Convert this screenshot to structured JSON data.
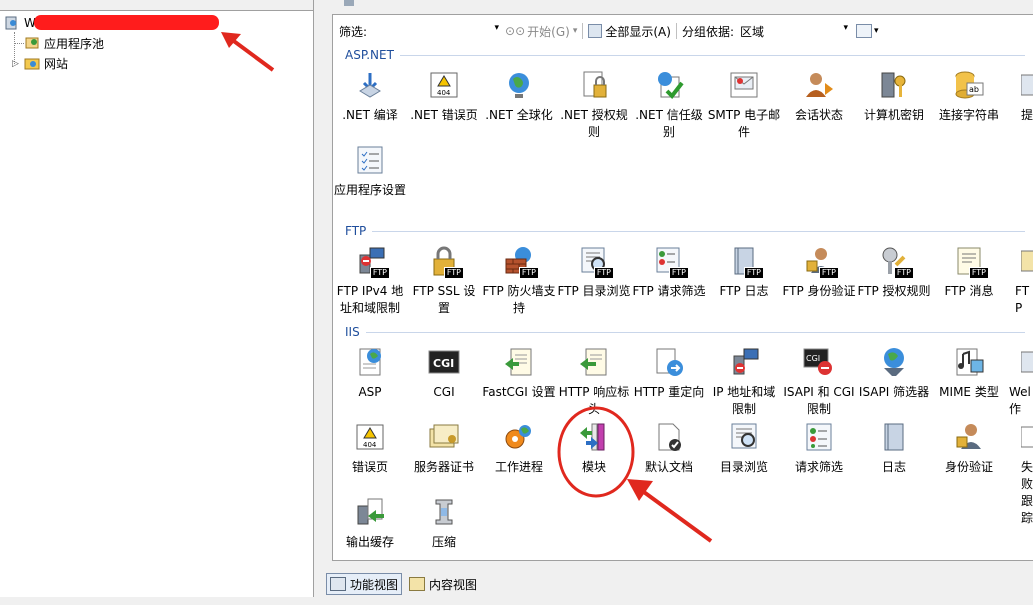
{
  "tree": {
    "server": "W",
    "items": [
      "应用程序池",
      "网站"
    ]
  },
  "toolbar": {
    "filter_label": "筛选:",
    "start_label": "开始(G)",
    "show_all_label": "全部显示(A)",
    "group_by_label": "分组依据:",
    "group_value": "区域"
  },
  "groups": {
    "aspnet": {
      "title": "ASP.NET",
      "items": [
        ".NET 编译",
        ".NET 错误页",
        ".NET 全球化",
        ".NET 授权规则",
        ".NET 信任级别",
        "SMTP 电子邮件",
        "会话状态",
        "计算机密钥",
        "连接字符串",
        "提",
        "应用程序设置"
      ]
    },
    "ftp": {
      "title": "FTP",
      "items": [
        "FTP IPv4 地址和域限制",
        "FTP SSL 设置",
        "FTP 防火墙支持",
        "FTP 目录浏览",
        "FTP 请求筛选",
        "FTP 日志",
        "FTP 身份验证",
        "FTP 授权规则",
        "FTP 消息",
        "FTP"
      ],
      "badge": "FTP"
    },
    "iis": {
      "title": "IIS",
      "items": [
        "ASP",
        "CGI",
        "FastCGI 设置",
        "HTTP 响应标头",
        "HTTP 重定向",
        "IP 地址和域限制",
        "ISAPI 和 CGI 限制",
        "ISAPI 筛选器",
        "MIME 类型",
        "Wel作",
        "错误页",
        "服务器证书",
        "工作进程",
        "模块",
        "默认文档",
        "目录浏览",
        "请求筛选",
        "日志",
        "身份验证",
        "失败跟踪",
        "输出缓存",
        "压缩"
      ],
      "cgi_text": "CGI",
      "page_404": "404"
    }
  },
  "bottom": {
    "features_view": "功能视图",
    "content_view": "内容视图"
  },
  "colors": {
    "annotation_red": "#e0281e",
    "group_blue": "#1f4e9c"
  }
}
